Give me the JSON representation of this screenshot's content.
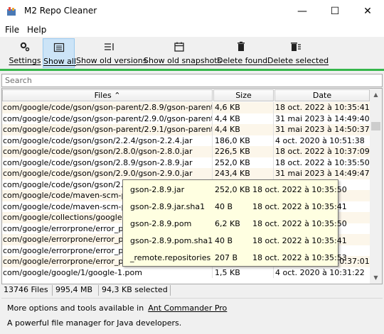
{
  "window": {
    "title": "M2 Repo Cleaner",
    "minimize": "—",
    "maximize": "☐",
    "close": "✕"
  },
  "menu": [
    "File",
    "Help"
  ],
  "toolbar": [
    {
      "label": "Settings",
      "icon": "gear-icon",
      "active": false
    },
    {
      "label": "Show all",
      "icon": "list-icon",
      "active": true
    },
    {
      "label": "Show old versions",
      "icon": "versions-icon",
      "active": false
    },
    {
      "label": "Show old snapshots",
      "icon": "calendar-icon",
      "active": false
    },
    {
      "label": "Delete found",
      "icon": "trash-icon",
      "active": false
    },
    {
      "label": "Delete selected",
      "icon": "trash-list-icon",
      "active": false
    }
  ],
  "search": {
    "placeholder": "Search"
  },
  "table": {
    "columns": {
      "files": "Files ⌃",
      "size": "Size",
      "date": "Date"
    },
    "rows": [
      {
        "file": "com/google/code/gson/gson-parent/2.8.9/gson-parent-2....",
        "size": "4,6 KB",
        "date": "18 oct. 2022 à 10:35:41"
      },
      {
        "file": "com/google/code/gson/gson-parent/2.9.0/gson-parent-2....",
        "size": "4,4 KB",
        "date": "31 mai 2023 à 14:49:40"
      },
      {
        "file": "com/google/code/gson/gson-parent/2.9.1/gson-parent-2....",
        "size": "4,4 KB",
        "date": "31 mai 2023 à 14:50:37"
      },
      {
        "file": "com/google/code/gson/gson/2.2.4/gson-2.2.4.jar",
        "size": "186,0 KB",
        "date": "4 oct. 2020 à 10:51:38"
      },
      {
        "file": "com/google/code/gson/gson/2.8.0/gson-2.8.0.jar",
        "size": "226,5 KB",
        "date": "18 oct. 2022 à 10:37:09"
      },
      {
        "file": "com/google/code/gson/gson/2.8.9/gson-2.8.9.jar",
        "size": "252,0 KB",
        "date": "18 oct. 2022 à 10:35:50"
      },
      {
        "file": "com/google/code/gson/gson/2.9.0/gson-2.9.0.jar",
        "size": "243,4 KB",
        "date": "31 mai 2023 à 14:49:47"
      },
      {
        "file": "com/google/code/gson/gson/2.9.1/g",
        "size": "",
        "date": "27"
      },
      {
        "file": "com/google/code/maven-scm-provid",
        "size": "",
        "date": "27"
      },
      {
        "file": "com/google/code/maven-scm-provid",
        "size": "",
        "date": "6:04"
      },
      {
        "file": "com/google/collections/google-collec",
        "size": "",
        "date": "1:40"
      },
      {
        "file": "com/google/errorprone/error_prone_",
        "size": "",
        "date": "0:43"
      },
      {
        "file": "com/google/errorprone/error_prone_",
        "size": "",
        "date": "7:08"
      },
      {
        "file": "com/google/errorprone/error_prone_",
        "size": "",
        "date": "0:39"
      },
      {
        "file": "com/google/errorprone/error_prone_parent/2.3.4/error_p...",
        "size": "3,3 KB",
        "date": "18 oct. 2022 à 10:37:01"
      },
      {
        "file": "com/google/google/1/google-1.pom",
        "size": "1,5 KB",
        "date": "4 oct. 2020 à 10:31:22"
      }
    ]
  },
  "tooltip": [
    {
      "name": "gson-2.8.9.jar",
      "size": "252,0 KB",
      "date": "18 oct. 2022 à 10:35:50"
    },
    {
      "name": "gson-2.8.9.jar.sha1",
      "size": "40 B",
      "date": "18 oct. 2022 à 10:35:41"
    },
    {
      "name": "gson-2.8.9.pom",
      "size": "6,2 KB",
      "date": "18 oct. 2022 à 10:35:50"
    },
    {
      "name": "gson-2.8.9.pom.sha1",
      "size": "40 B",
      "date": "18 oct. 2022 à 10:35:41"
    },
    {
      "name": "_remote.repositories",
      "size": "207 B",
      "date": "18 oct. 2022 à 10:35:53"
    }
  ],
  "status": {
    "files": "13746 Files",
    "total": "995,4 MB",
    "selected": "94,3 KB selected"
  },
  "promo": {
    "line1": "More options and tools available in",
    "link": "Ant Commander Pro",
    "line2": "A powerful file manager for Java developers."
  }
}
